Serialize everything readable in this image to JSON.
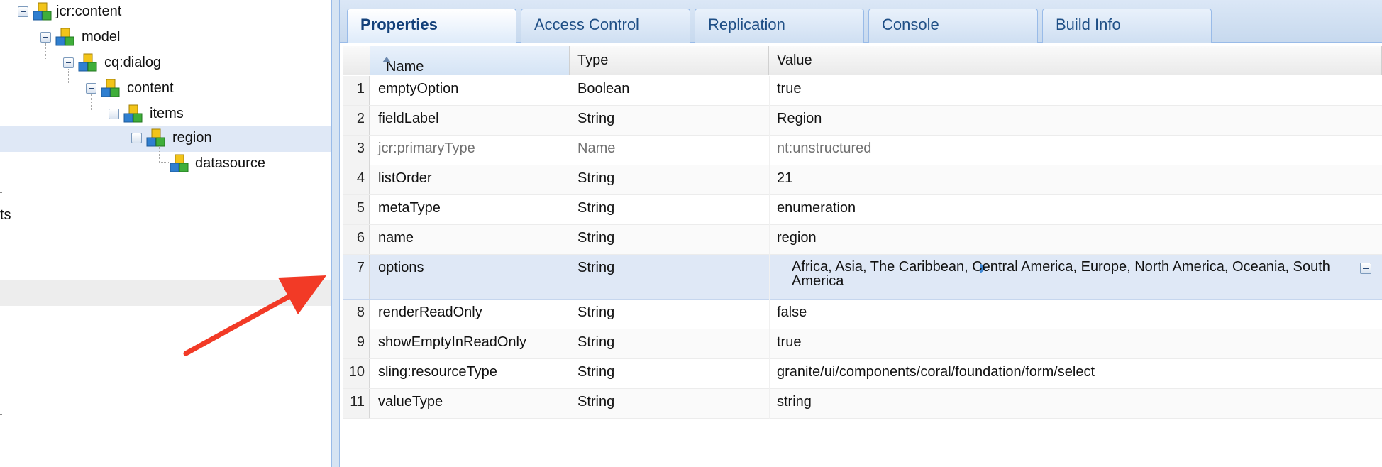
{
  "tree": {
    "nodes": [
      {
        "label": "jcr:content",
        "depth": 0,
        "expanded": true
      },
      {
        "label": "model",
        "depth": 1,
        "expanded": true
      },
      {
        "label": "cq:dialog",
        "depth": 2,
        "expanded": true
      },
      {
        "label": "content",
        "depth": 3,
        "expanded": true
      },
      {
        "label": "items",
        "depth": 4,
        "expanded": true
      },
      {
        "label": "region",
        "depth": 5,
        "expanded": true,
        "selected": true
      },
      {
        "label": "datasource",
        "depth": 6,
        "expanded": false
      }
    ],
    "partial_label": "ts"
  },
  "tabs": [
    {
      "label": "Properties",
      "active": true
    },
    {
      "label": "Access Control",
      "active": false
    },
    {
      "label": "Replication",
      "active": false
    },
    {
      "label": "Console",
      "active": false
    },
    {
      "label": "Build Info",
      "active": false
    }
  ],
  "grid": {
    "columns": {
      "name": "Name",
      "type": "Type",
      "value": "Value"
    },
    "sort": {
      "column": "Name",
      "direction": "ascending"
    },
    "rows": [
      {
        "num": "1",
        "name": "emptyOption",
        "type": "Boolean",
        "value": "true"
      },
      {
        "num": "2",
        "name": "fieldLabel",
        "type": "String",
        "value": "Region"
      },
      {
        "num": "3",
        "name": "jcr:primaryType",
        "type": "Name",
        "value": "nt:unstructured",
        "dim": true
      },
      {
        "num": "4",
        "name": "listOrder",
        "type": "String",
        "value": "21"
      },
      {
        "num": "5",
        "name": "metaType",
        "type": "String",
        "value": "enumeration"
      },
      {
        "num": "6",
        "name": "name",
        "type": "String",
        "value": "region"
      },
      {
        "num": "7",
        "name": "options",
        "type": "String",
        "value": "Africa, Asia, The Caribbean, Central America, Europe, North America, Oceania, South America",
        "selected": true,
        "multi": true
      },
      {
        "num": "8",
        "name": "renderReadOnly",
        "type": "String",
        "value": "false"
      },
      {
        "num": "9",
        "name": "showEmptyInReadOnly",
        "type": "String",
        "value": "true"
      },
      {
        "num": "10",
        "name": "sling:resourceType",
        "type": "String",
        "value": "granite/ui/components/coral/foundation/form/select"
      },
      {
        "num": "11",
        "name": "valueType",
        "type": "String",
        "value": "string"
      }
    ]
  },
  "colors": {
    "accent": "#14417a",
    "selection": "#dfe8f6",
    "annotation_arrow": "#f23a26"
  },
  "icons": {
    "tree_node": "node-cubes-icon",
    "toggle": "collapse-toggle-icon",
    "expand": "expand-triangle-icon",
    "sort": "sort-ascending-icon"
  }
}
